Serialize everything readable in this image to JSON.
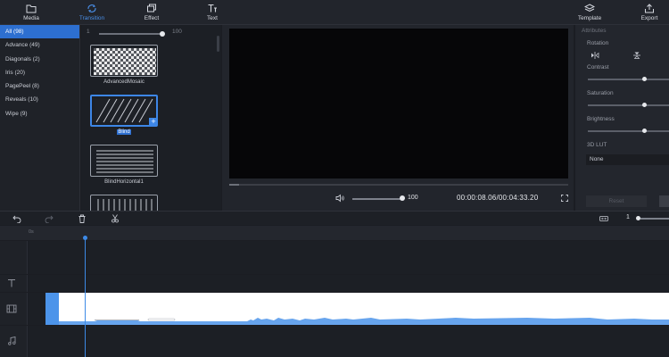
{
  "toolbar": {
    "media": "Media",
    "transition": "Transition",
    "effect": "Effect",
    "text": "Text",
    "template": "Template",
    "export": "Export"
  },
  "categories": [
    {
      "label": "All (98)"
    },
    {
      "label": "Advance (49)"
    },
    {
      "label": "Diagonals (2)"
    },
    {
      "label": "Iris (20)"
    },
    {
      "label": "PagePeel (8)"
    },
    {
      "label": "Reveals (10)"
    },
    {
      "label": "Wipe (9)"
    }
  ],
  "transitions": {
    "duration_min": "1",
    "duration_max": "100",
    "items": [
      {
        "label": "AdvancedMosaic"
      },
      {
        "label": "Blind"
      },
      {
        "label": "BlindHorizontal1"
      }
    ]
  },
  "player": {
    "volume": "100",
    "time": "00:00:08.06/00:04:33.20",
    "progress": 0.03
  },
  "attributes": {
    "title": "Attributes",
    "rotation": "Rotation",
    "contrast": "Contrast",
    "saturation": "Saturation",
    "brightness": "Brightness",
    "lut": "3D LUT",
    "lut_value": "None",
    "reset": "Reset",
    "contrast_level": 0.7,
    "saturation_level": 0.7,
    "brightness_level": 0.7
  },
  "timeline": {
    "zoom": "1",
    "ruler_zero": "0s"
  },
  "colors": {
    "accent": "#3d86e6",
    "background": "#1b1d23",
    "panel": "#22252c"
  }
}
